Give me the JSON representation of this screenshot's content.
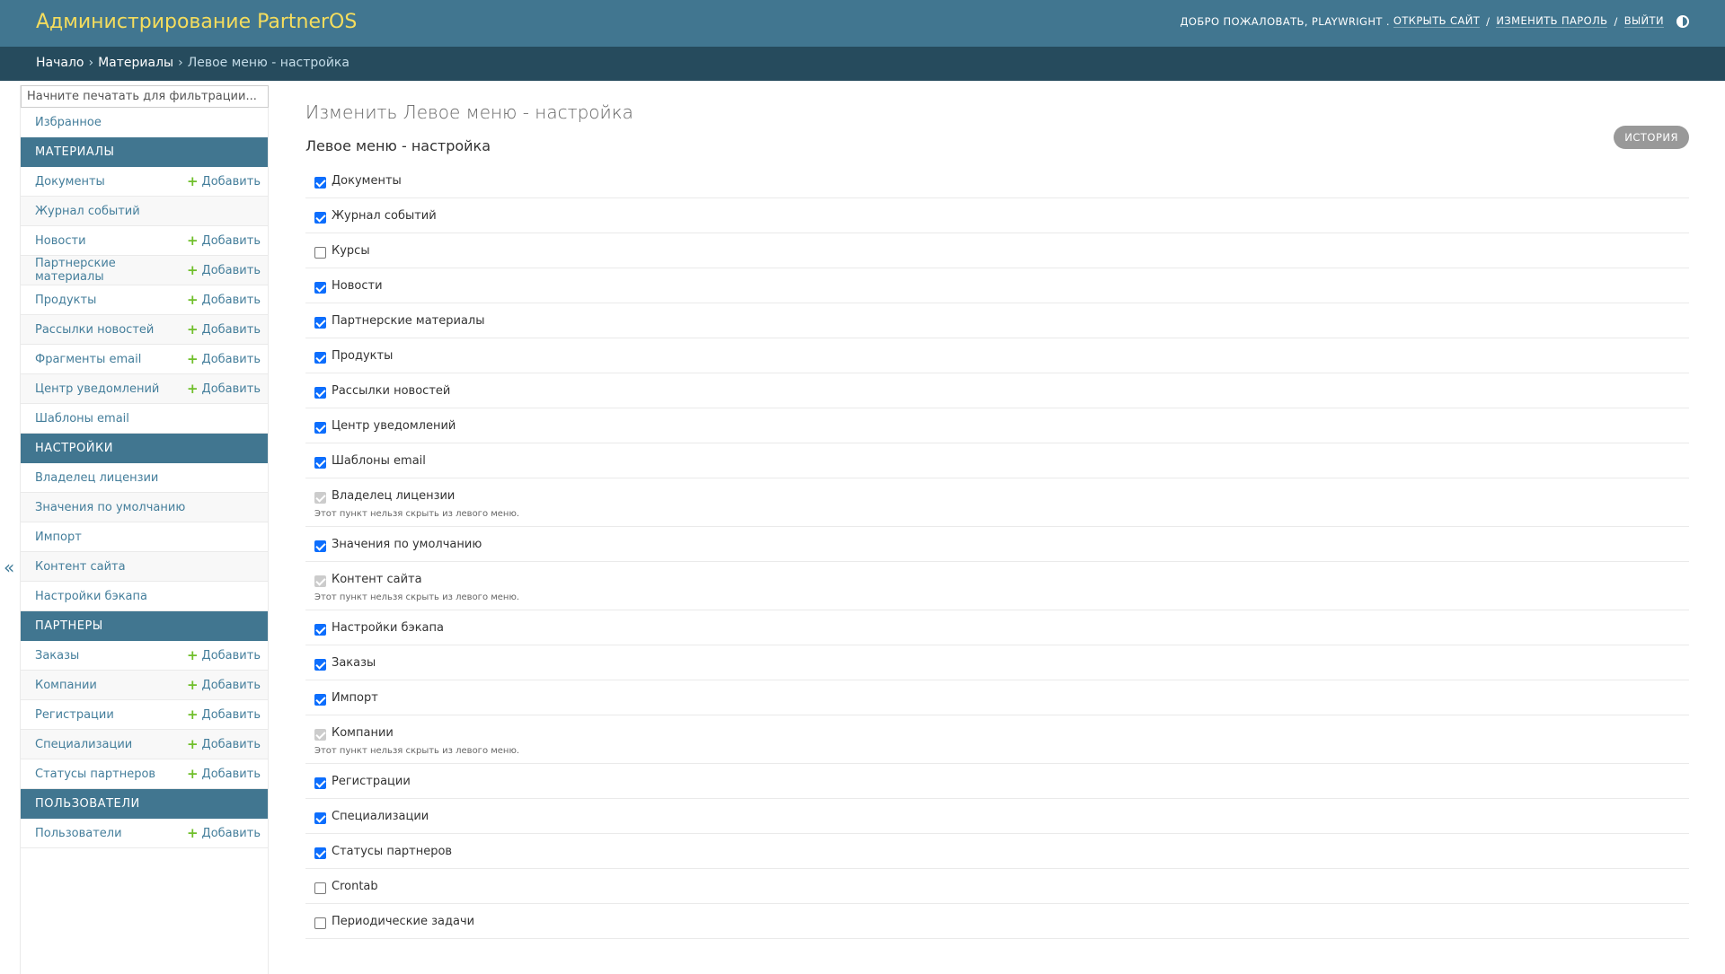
{
  "header": {
    "title": "Администрирование PartnerOS",
    "welcome": "Добро пожаловать,",
    "username": "playwright",
    "open_site": "Открыть сайт",
    "change_password": "Изменить пароль",
    "logout": "Выйти"
  },
  "breadcrumbs": {
    "home": "Начало",
    "section": "Материалы",
    "current": "Левое меню - настройка"
  },
  "sidebar": {
    "filter_placeholder": "Начните печатать для фильтрации...",
    "favorites": "Избранное",
    "add_label": "Добавить",
    "collapse_symbol": "«",
    "modules": [
      {
        "caption": "Материалы",
        "items": [
          {
            "label": "Документы",
            "add": true
          },
          {
            "label": "Журнал событий",
            "add": false
          },
          {
            "label": "Новости",
            "add": true
          },
          {
            "label": "Партнерские материалы",
            "add": true
          },
          {
            "label": "Продукты",
            "add": true
          },
          {
            "label": "Рассылки новостей",
            "add": true
          },
          {
            "label": "Фрагменты email",
            "add": true
          },
          {
            "label": "Центр уведомлений",
            "add": true
          },
          {
            "label": "Шаблоны email",
            "add": false
          }
        ]
      },
      {
        "caption": "Настройки",
        "items": [
          {
            "label": "Владелец лицензии",
            "add": false
          },
          {
            "label": "Значения по умолчанию",
            "add": false
          },
          {
            "label": "Импорт",
            "add": false
          },
          {
            "label": "Контент сайта",
            "add": false
          },
          {
            "label": "Настройки бэкапа",
            "add": false
          }
        ]
      },
      {
        "caption": "Партнеры",
        "items": [
          {
            "label": "Заказы",
            "add": true
          },
          {
            "label": "Компании",
            "add": true
          },
          {
            "label": "Регистрации",
            "add": true
          },
          {
            "label": "Специализации",
            "add": true
          },
          {
            "label": "Статусы партнеров",
            "add": true
          }
        ]
      },
      {
        "caption": "Пользователи",
        "items": [
          {
            "label": "Пользователи",
            "add": true
          }
        ]
      }
    ]
  },
  "main": {
    "title": "Изменить Левое меню - настройка",
    "history": "История",
    "fieldset_title": "Левое меню - настройка",
    "help_text": "Этот пункт нельзя скрыть из левого меню.",
    "options": [
      {
        "label": "Документы",
        "state": "checked"
      },
      {
        "label": "Журнал событий",
        "state": "checked"
      },
      {
        "label": "Курсы",
        "state": "unchecked"
      },
      {
        "label": "Новости",
        "state": "checked"
      },
      {
        "label": "Партнерские материалы",
        "state": "checked"
      },
      {
        "label": "Продукты",
        "state": "checked"
      },
      {
        "label": "Рассылки новостей",
        "state": "checked"
      },
      {
        "label": "Центр уведомлений",
        "state": "checked"
      },
      {
        "label": "Шаблоны email",
        "state": "checked"
      },
      {
        "label": "Владелец лицензии",
        "state": "disabled"
      },
      {
        "label": "Значения по умолчанию",
        "state": "checked"
      },
      {
        "label": "Контент сайта",
        "state": "disabled"
      },
      {
        "label": "Настройки бэкапа",
        "state": "checked"
      },
      {
        "label": "Заказы",
        "state": "checked"
      },
      {
        "label": "Импорт",
        "state": "checked"
      },
      {
        "label": "Компании",
        "state": "disabled"
      },
      {
        "label": "Регистрации",
        "state": "checked"
      },
      {
        "label": "Специализации",
        "state": "checked"
      },
      {
        "label": "Статусы партнеров",
        "state": "checked"
      },
      {
        "label": "Crontab",
        "state": "unchecked"
      },
      {
        "label": "Периодические задачи",
        "state": "unchecked"
      }
    ]
  },
  "colors": {
    "header_bg": "#417690",
    "breadcrumb_bg": "#264b5d",
    "brand_title": "#f5dd5d",
    "link": "#447e9b",
    "add_icon": "#70bf2b",
    "checkbox": "#0d6efd"
  }
}
